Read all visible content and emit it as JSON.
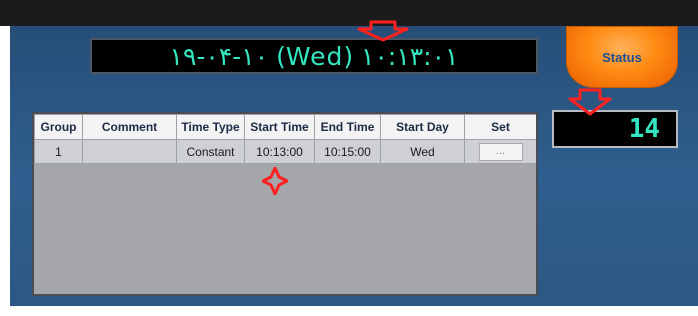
{
  "clock": {
    "display": "۱۹-۰۴-۱۰ (Wed) ۱۰:۱۳:۰۱"
  },
  "status_button": {
    "label": "Status"
  },
  "counter": {
    "value": "14"
  },
  "table": {
    "columns": [
      "Group",
      "Comment",
      "Time Type",
      "Start Time",
      "End Time",
      "Start Day",
      "Set"
    ],
    "rows": [
      {
        "group": "1",
        "comment": "",
        "time_type": "Constant",
        "start_time": "10:13:00",
        "end_time": "10:15:00",
        "start_day": "Wed",
        "set_label": "..."
      }
    ]
  },
  "colors": {
    "accent_marker": "#ff2020",
    "led_text": "#35e6c2",
    "status_orange": "#ff8a12"
  }
}
